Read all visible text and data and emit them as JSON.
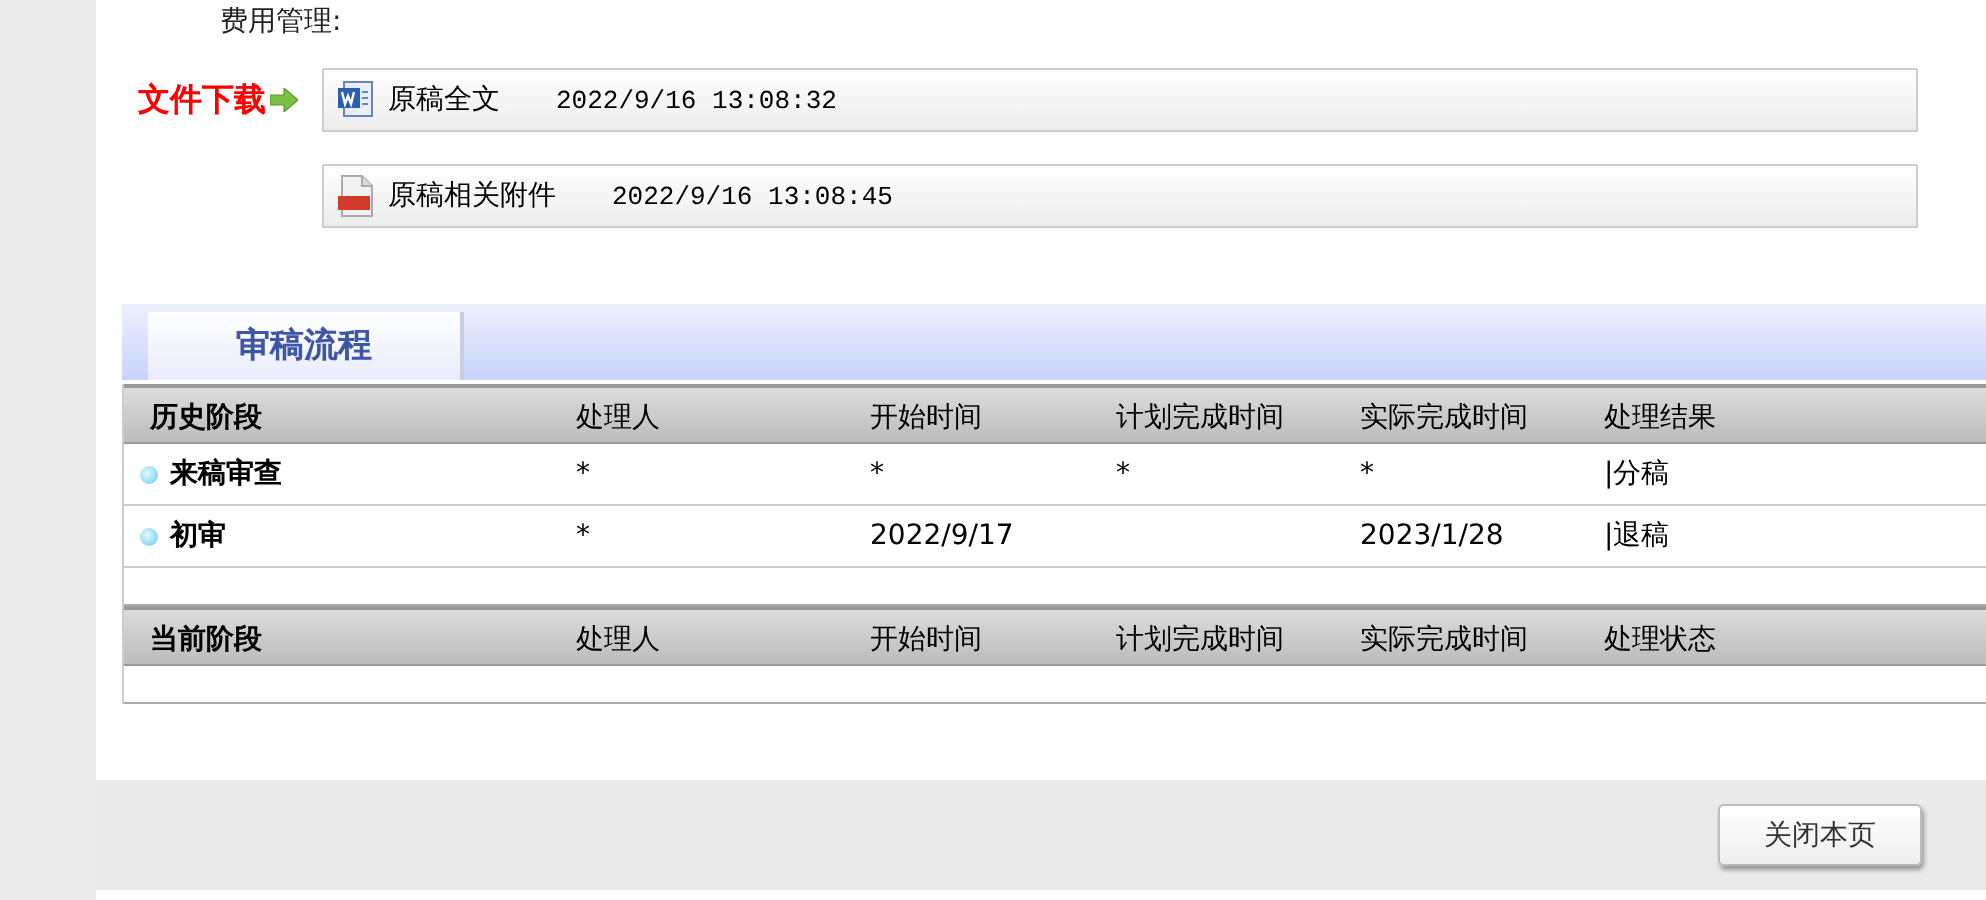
{
  "fee_label": "费用管理:",
  "download_label": "文件下载",
  "files": [
    {
      "kind": "word",
      "name": "原稿全文",
      "time": "2022/9/16 13:08:32"
    },
    {
      "kind": "pdf",
      "name": "原稿相关附件",
      "time": "2022/9/16 13:08:45"
    }
  ],
  "tab": {
    "label": "审稿流程"
  },
  "history": {
    "columns": [
      "历史阶段",
      "处理人",
      "开始时间",
      "计划完成时间",
      "实际完成时间",
      "处理结果"
    ],
    "rows": [
      [
        "来稿审查",
        "*",
        "*",
        "*",
        "*",
        "|分稿"
      ],
      [
        "初审",
        "*",
        "2022/9/17",
        "",
        "2023/1/28",
        "|退稿"
      ]
    ]
  },
  "current": {
    "columns": [
      "当前阶段",
      "处理人",
      "开始时间",
      "计划完成时间",
      "实际完成时间",
      "处理状态"
    ]
  },
  "close_button": "关闭本页"
}
